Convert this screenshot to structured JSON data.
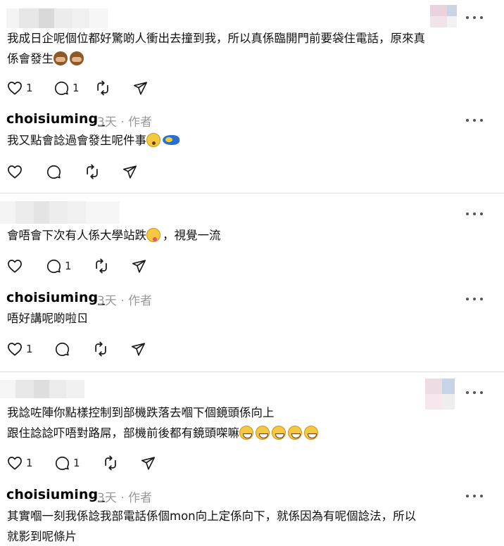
{
  "comments": [
    {
      "text_lines": [
        "我成日企呢個位都好驚啲人衝出去撞到我，所以真係臨開門前要袋住電話，原來真",
        "係會發生"
      ],
      "emoji": [
        "see-no-evil-monkey",
        "see-no-evil-monkey"
      ],
      "likes": "1",
      "replies": "1"
    },
    {
      "username": "choisiuming_",
      "time": "3天",
      "author_tag": "· 作者",
      "text": "我又點會諗過會發生呢件事",
      "emoji": [
        "flushed-face",
        "fish"
      ]
    },
    {
      "text": "會唔會下次有人係大學站跌",
      "text_suffix": "，視覺一流",
      "emoji": [
        "tongue-face"
      ],
      "replies": "1"
    },
    {
      "username": "choisiuming_",
      "time": "3天",
      "author_tag": "· 作者",
      "text": "唔好講呢啲啦",
      "text_end": "ㄖ",
      "likes": "1"
    },
    {
      "text_lines": [
        "我諗咗陣你點樣控制到部機跌落去嗰下個鏡頭係向上",
        "跟住諗諗吓唔對路屌，部機前後都有鏡頭㗎嘛"
      ],
      "emoji": [
        "grinning-sweat",
        "grinning-sweat",
        "grinning-sweat",
        "grinning-sweat",
        "grinning-sweat"
      ],
      "likes": "1",
      "replies": "1"
    },
    {
      "username": "choisiuming_",
      "time": "3天",
      "author_tag": "· 作者",
      "text_lines": [
        "其實嗰一刻我係諗我部電話係個mon向上定係向下，就係因為有呢個諗法，所以",
        "就影到呢條片"
      ]
    }
  ],
  "icons": {
    "like": "heart-icon",
    "reply": "speech-bubble-icon",
    "repost": "repost-arrows-icon",
    "share": "send-icon",
    "more": "more-dots-icon"
  },
  "colors": {
    "text": "#111111",
    "meta": "#999999",
    "divider": "#dcdcdc",
    "icon": "#1a1a1a"
  }
}
